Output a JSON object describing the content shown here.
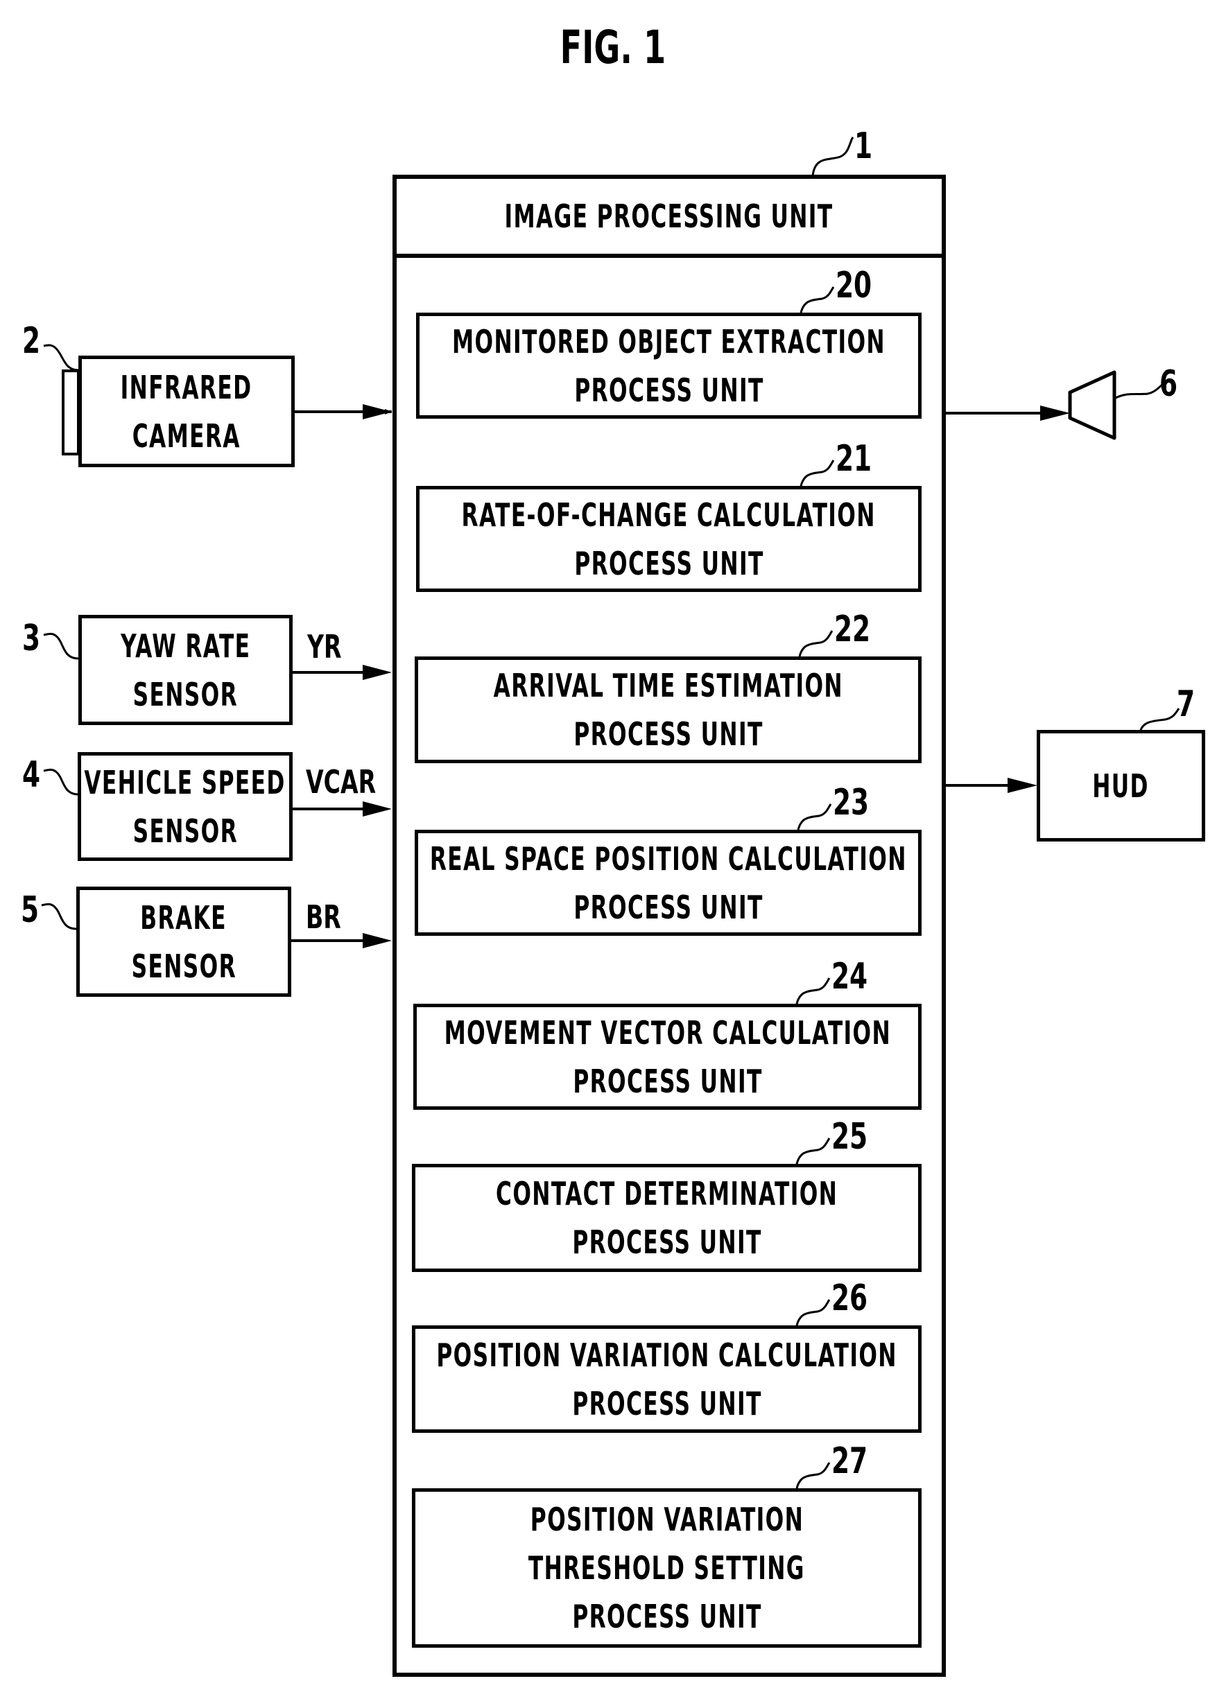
{
  "figure": {
    "title": "FIG. 1"
  },
  "main_unit": {
    "ref": "1",
    "title": "IMAGE PROCESSING UNIT",
    "process_units": [
      {
        "ref": "20",
        "lines": [
          "MONITORED OBJECT EXTRACTION",
          "PROCESS UNIT"
        ]
      },
      {
        "ref": "21",
        "lines": [
          "RATE-OF-CHANGE CALCULATION",
          "PROCESS UNIT"
        ]
      },
      {
        "ref": "22",
        "lines": [
          "ARRIVAL TIME ESTIMATION",
          "PROCESS UNIT"
        ]
      },
      {
        "ref": "23",
        "lines": [
          "REAL SPACE POSITION CALCULATION",
          "PROCESS UNIT"
        ]
      },
      {
        "ref": "24",
        "lines": [
          "MOVEMENT VECTOR CALCULATION",
          "PROCESS UNIT"
        ]
      },
      {
        "ref": "25",
        "lines": [
          "CONTACT DETERMINATION",
          "PROCESS UNIT"
        ]
      },
      {
        "ref": "26",
        "lines": [
          "POSITION VARIATION CALCULATION",
          "PROCESS UNIT"
        ]
      },
      {
        "ref": "27",
        "lines": [
          "POSITION VARIATION",
          "THRESHOLD SETTING",
          "PROCESS UNIT"
        ]
      }
    ]
  },
  "inputs": [
    {
      "ref": "2",
      "lines": [
        "INFRARED",
        "CAMERA"
      ],
      "signal": ""
    },
    {
      "ref": "3",
      "lines": [
        "YAW RATE",
        "SENSOR"
      ],
      "signal": "YR"
    },
    {
      "ref": "4",
      "lines": [
        "VEHICLE SPEED",
        "SENSOR"
      ],
      "signal": "VCAR"
    },
    {
      "ref": "5",
      "lines": [
        "BRAKE",
        "SENSOR"
      ],
      "signal": "BR"
    }
  ],
  "outputs": [
    {
      "ref": "6",
      "icon": "speaker-icon",
      "label": ""
    },
    {
      "ref": "7",
      "label": "HUD"
    }
  ]
}
